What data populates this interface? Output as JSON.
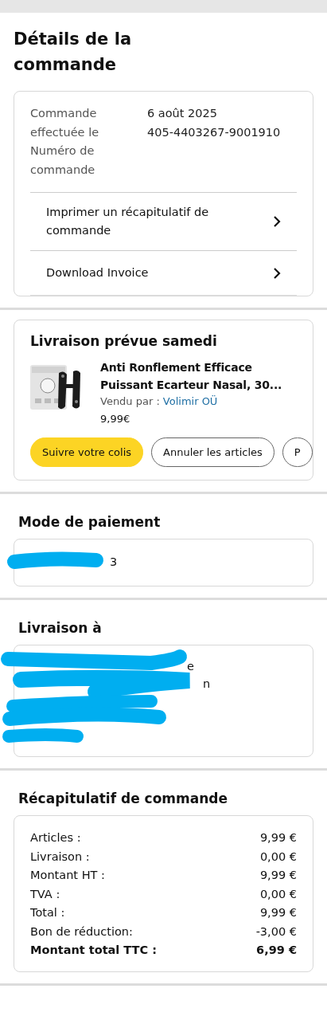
{
  "title": "Détails de la commande",
  "order_info": {
    "labels": [
      "Commande effectuée le",
      "Numéro de commande"
    ],
    "values": [
      "6 août 2025",
      "405-4403267-9001910"
    ]
  },
  "links": [
    {
      "label": "Imprimer un récapitulatif de commande"
    },
    {
      "label": "Download Invoice"
    }
  ],
  "shipment": {
    "heading": "Livraison prévue samedi",
    "product": {
      "title": "Anti Ronflement Efficace Puissant Ecarteur Nasal, 30...",
      "seller_label": "Vendu par  :",
      "seller": "Volimir OÜ",
      "price": "9,99€"
    },
    "actions": [
      {
        "label": "Suivre votre colis",
        "kind": "primary"
      },
      {
        "label": "Annuler les articles",
        "kind": "secondary"
      },
      {
        "label": "P",
        "kind": "secondary"
      }
    ]
  },
  "payment": {
    "heading": "Mode de paiement",
    "visible_text": [
      "3"
    ]
  },
  "address": {
    "heading": "Livraison à",
    "visible_text": [
      "e",
      "n"
    ]
  },
  "summary": {
    "heading": "Récapitulatif de commande",
    "rows": [
      {
        "label": "Articles :",
        "value": "9,99 €",
        "kind": "normal"
      },
      {
        "label": "Livraison :",
        "value": "0,00 €",
        "kind": "normal"
      },
      {
        "label": "Montant HT :",
        "value": "9,99 €",
        "kind": "normal"
      },
      {
        "label": "TVA :",
        "value": "0,00 €",
        "kind": "normal"
      },
      {
        "label": "Total :",
        "value": "9,99 €",
        "kind": "normal"
      },
      {
        "label": "Bon de réduction:",
        "value": "-3,00 €",
        "kind": "normal"
      },
      {
        "label": "Montant total TTC :",
        "value": "6,99 €",
        "kind": "total"
      }
    ]
  }
}
